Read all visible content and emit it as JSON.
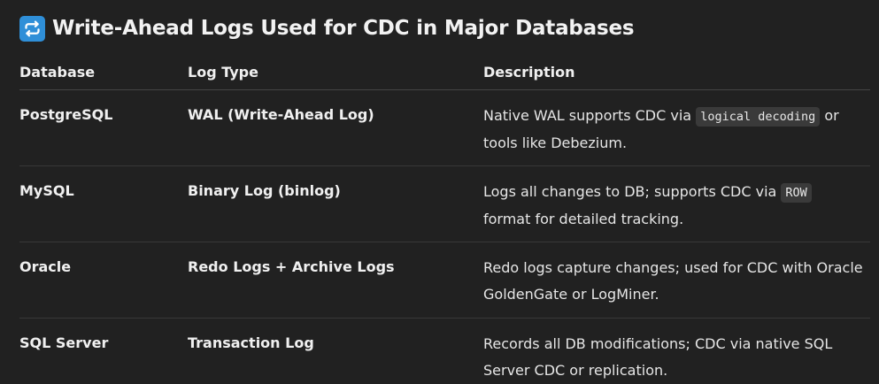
{
  "heading": {
    "icon": "repeat-arrows-icon",
    "title": "Write-Ahead Logs Used for CDC in Major Databases"
  },
  "table": {
    "headers": [
      "Database",
      "Log Type",
      "Description"
    ],
    "rows": [
      {
        "database": "PostgreSQL",
        "log_type": "WAL (Write-Ahead Log)",
        "desc_before": "Native WAL supports CDC via ",
        "desc_code": "logical decoding",
        "desc_after": " or tools like Debezium."
      },
      {
        "database": "MySQL",
        "log_type": "Binary Log (binlog)",
        "desc_before": "Logs all changes to DB; supports CDC via ",
        "desc_code": "ROW",
        "desc_after": " format for detailed tracking."
      },
      {
        "database": "Oracle",
        "log_type": "Redo Logs + Archive Logs",
        "desc_before": "Redo logs capture changes; used for CDC with Oracle GoldenGate or LogMiner.",
        "desc_code": "",
        "desc_after": ""
      },
      {
        "database": "SQL Server",
        "log_type": "Transaction Log",
        "desc_before": "Records all DB modifications; CDC via native SQL Server CDC or replication.",
        "desc_code": "",
        "desc_after": ""
      }
    ]
  }
}
